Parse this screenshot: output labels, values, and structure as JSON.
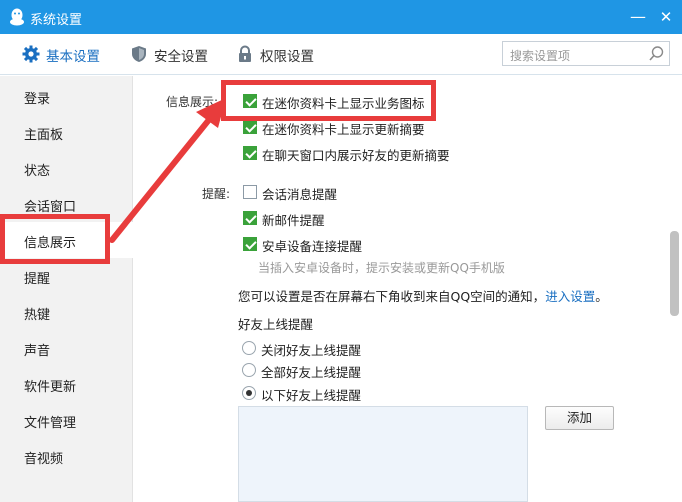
{
  "window": {
    "title": "系统设置",
    "minimize_glyph": "—",
    "close_glyph": "✕"
  },
  "tabs": [
    {
      "label": "基本设置",
      "icon": "gear-icon",
      "active": true
    },
    {
      "label": "安全设置",
      "icon": "shield-icon",
      "active": false
    },
    {
      "label": "权限设置",
      "icon": "lock-icon",
      "active": false
    }
  ],
  "search": {
    "placeholder": "搜索设置项",
    "icon": "search-icon"
  },
  "sidebar": {
    "items": [
      {
        "label": "登录"
      },
      {
        "label": "主面板"
      },
      {
        "label": "状态"
      },
      {
        "label": "会话窗口"
      },
      {
        "label": "信息展示",
        "active": true
      },
      {
        "label": "提醒"
      },
      {
        "label": "热键"
      },
      {
        "label": "声音"
      },
      {
        "label": "软件更新"
      },
      {
        "label": "文件管理"
      },
      {
        "label": "音视频"
      }
    ]
  },
  "info_display": {
    "label": "信息展示:",
    "options": [
      {
        "label": "在迷你资料卡上显示业务图标",
        "checked": true
      },
      {
        "label": "在迷你资料卡上显示更新摘要",
        "checked": true
      },
      {
        "label": "在聊天窗口内展示好友的更新摘要",
        "checked": true
      }
    ]
  },
  "reminders": {
    "label": "提醒:",
    "options": [
      {
        "label": "会话消息提醒",
        "checked": false
      },
      {
        "label": "新邮件提醒",
        "checked": true
      },
      {
        "label": "安卓设备连接提醒",
        "checked": true
      }
    ],
    "hint": "当插入安卓设备时，提示安装或更新QQ手机版"
  },
  "qzone_notice": {
    "text": "您可以设置是否在屏幕右下角收到来自QQ空间的通知，",
    "link": "进入设置",
    "suffix": "。"
  },
  "friend_online": {
    "label": "好友上线提醒",
    "options": [
      {
        "label": "关闭好友上线提醒",
        "selected": false
      },
      {
        "label": "全部好友上线提醒",
        "selected": false
      },
      {
        "label": "以下好友上线提醒",
        "selected": true
      }
    ],
    "add_button": "添加"
  },
  "colors": {
    "titlebar": "#1f96e4",
    "accent": "#1a6fc1",
    "check_green": "#3aa23a",
    "annotation_red": "#e83c3c"
  }
}
